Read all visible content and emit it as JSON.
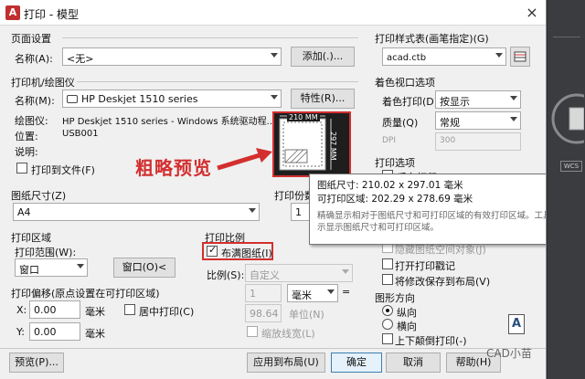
{
  "window": {
    "title": "打印 - 模型",
    "close_glyph": "×"
  },
  "page_setup": {
    "group_label": "页面设置",
    "name_label": "名称(A):",
    "name_value": "<无>",
    "add_button": "添加(.)..."
  },
  "printer": {
    "group_label": "打印机/绘图仪",
    "name_label": "名称(M):",
    "name_value": "HP Deskjet 1510 series",
    "properties_button": "特性(R)...",
    "plotter_label": "绘图仪:",
    "plotter_value": "HP Deskjet 1510 series - Windows 系统驱动程...",
    "location_label": "位置:",
    "location_value": "USB001",
    "description_label": "说明:",
    "print_to_file_label": "打印到文件(F)",
    "print_to_file_checked": false
  },
  "preview": {
    "width_label": "210 MM",
    "height_label": "297 MM",
    "annotation_text": "粗略预览"
  },
  "paper_size": {
    "group_label": "图纸尺寸(Z)",
    "value": "A4"
  },
  "copies": {
    "group_label": "打印份数",
    "value": "1"
  },
  "plot_area": {
    "group_label": "打印区域",
    "range_label": "打印范围(W):",
    "range_value": "窗口",
    "window_button": "窗口(O)<"
  },
  "plot_offset": {
    "group_label": "打印偏移(原点设置在可打印区域)",
    "x_label": "X:",
    "x_value": "0.00",
    "x_unit": "毫米",
    "y_label": "Y:",
    "y_value": "0.00",
    "y_unit": "毫米",
    "center_label": "居中打印(C)",
    "center_checked": false
  },
  "plot_scale": {
    "group_label": "打印比例",
    "fit_label": "布满图纸(I)",
    "fit_checked": true,
    "scale_label": "比例(S):",
    "scale_value": "自定义",
    "value1": "1",
    "unit1": "毫米",
    "equals": "=",
    "value2": "98.64",
    "unit2": "单位(N)",
    "lineweights_label": "缩放线宽(L)"
  },
  "plot_style": {
    "group_label": "打印样式表(画笔指定)(G)",
    "value": "acad.ctb"
  },
  "shaded_viewport": {
    "group_label": "着色视口选项",
    "shade_label": "着色打印(D)",
    "shade_value": "按显示",
    "quality_label": "质量(Q)",
    "quality_value": "常规",
    "dpi_label": "DPI",
    "dpi_value": "300"
  },
  "plot_options": {
    "group_label": "打印选项",
    "background_label": "后台打印(K)",
    "hide_label": "隐藏图纸空间对象(J)",
    "stamp_label": "打开打印戳记",
    "save_label": "将修改保存到布局(V)"
  },
  "orientation": {
    "group_label": "图形方向",
    "portrait_label": "纵向",
    "landscape_label": "横向",
    "upside_down_label": "上下颠倒打印(-)",
    "icon_letter": "A"
  },
  "tooltip": {
    "paper_size_line": "图纸尺寸: 210.02 x 297.01 毫米",
    "printable_line": "可打印区域: 202.29 x 278.69 毫米",
    "description": "精确显示相对于图纸尺寸和可打印区域的有效打印区域。工具提示显示图纸尺寸和可打印区域。"
  },
  "footer": {
    "preview_button": "预览(P)...",
    "apply_button": "应用到布局(U)",
    "ok_button": "确定",
    "cancel_button": "取消",
    "help_button": "帮助(H)"
  },
  "watermark": "CAD小苗",
  "colors": {
    "annotation_red": "#d32f2f",
    "dialog_bg": "#f0f0f0",
    "accent_blue": "#3c7fb1"
  }
}
